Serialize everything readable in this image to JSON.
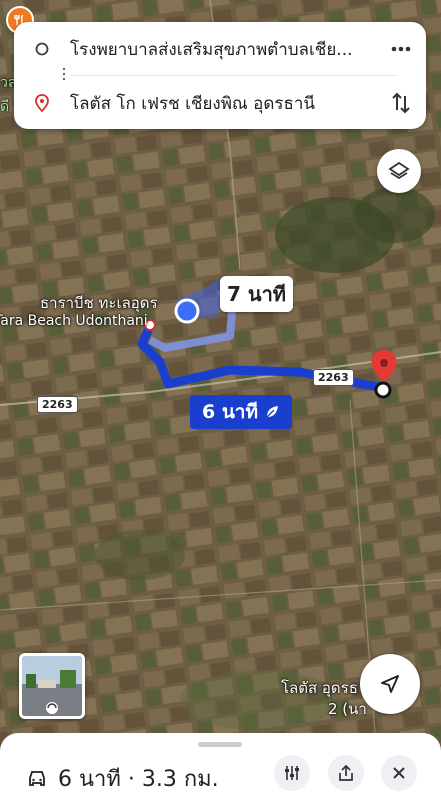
{
  "route": {
    "origin": "โรงพยาบาลส่งเสริมสุขภาพตำบลเชีย...",
    "destination": "โลตัส โก เฟรช เชียงพิณ อุดรธานี"
  },
  "map": {
    "place_label_th": "ธาราบีช ทะเลอุดร",
    "place_label_en": "Tara Beach Udonthani",
    "road_shield_1": "2263",
    "road_shield_2": "2263",
    "alt_route_time": "7 นาที",
    "main_route_time": "6 นาที",
    "bottom_label_line1": "โลตัส อุดรธ",
    "bottom_label_line2": "2 (นา",
    "edge_label_1": "วล",
    "edge_label_2": "ดี"
  },
  "sheet": {
    "summary": "6 นาที · 3.3 กม."
  },
  "colors": {
    "route_blue": "#1a3fcf",
    "alt_route": "#5b73d6",
    "pin_red": "#e53935"
  },
  "icons": [
    "map-pin-icon",
    "origin-circle-icon",
    "more-icon",
    "swap-icon",
    "layers-icon",
    "navigate-icon",
    "car-icon",
    "leaf-icon",
    "options-icon",
    "share-icon",
    "close-icon",
    "streetview-icon",
    "pin-icon"
  ]
}
